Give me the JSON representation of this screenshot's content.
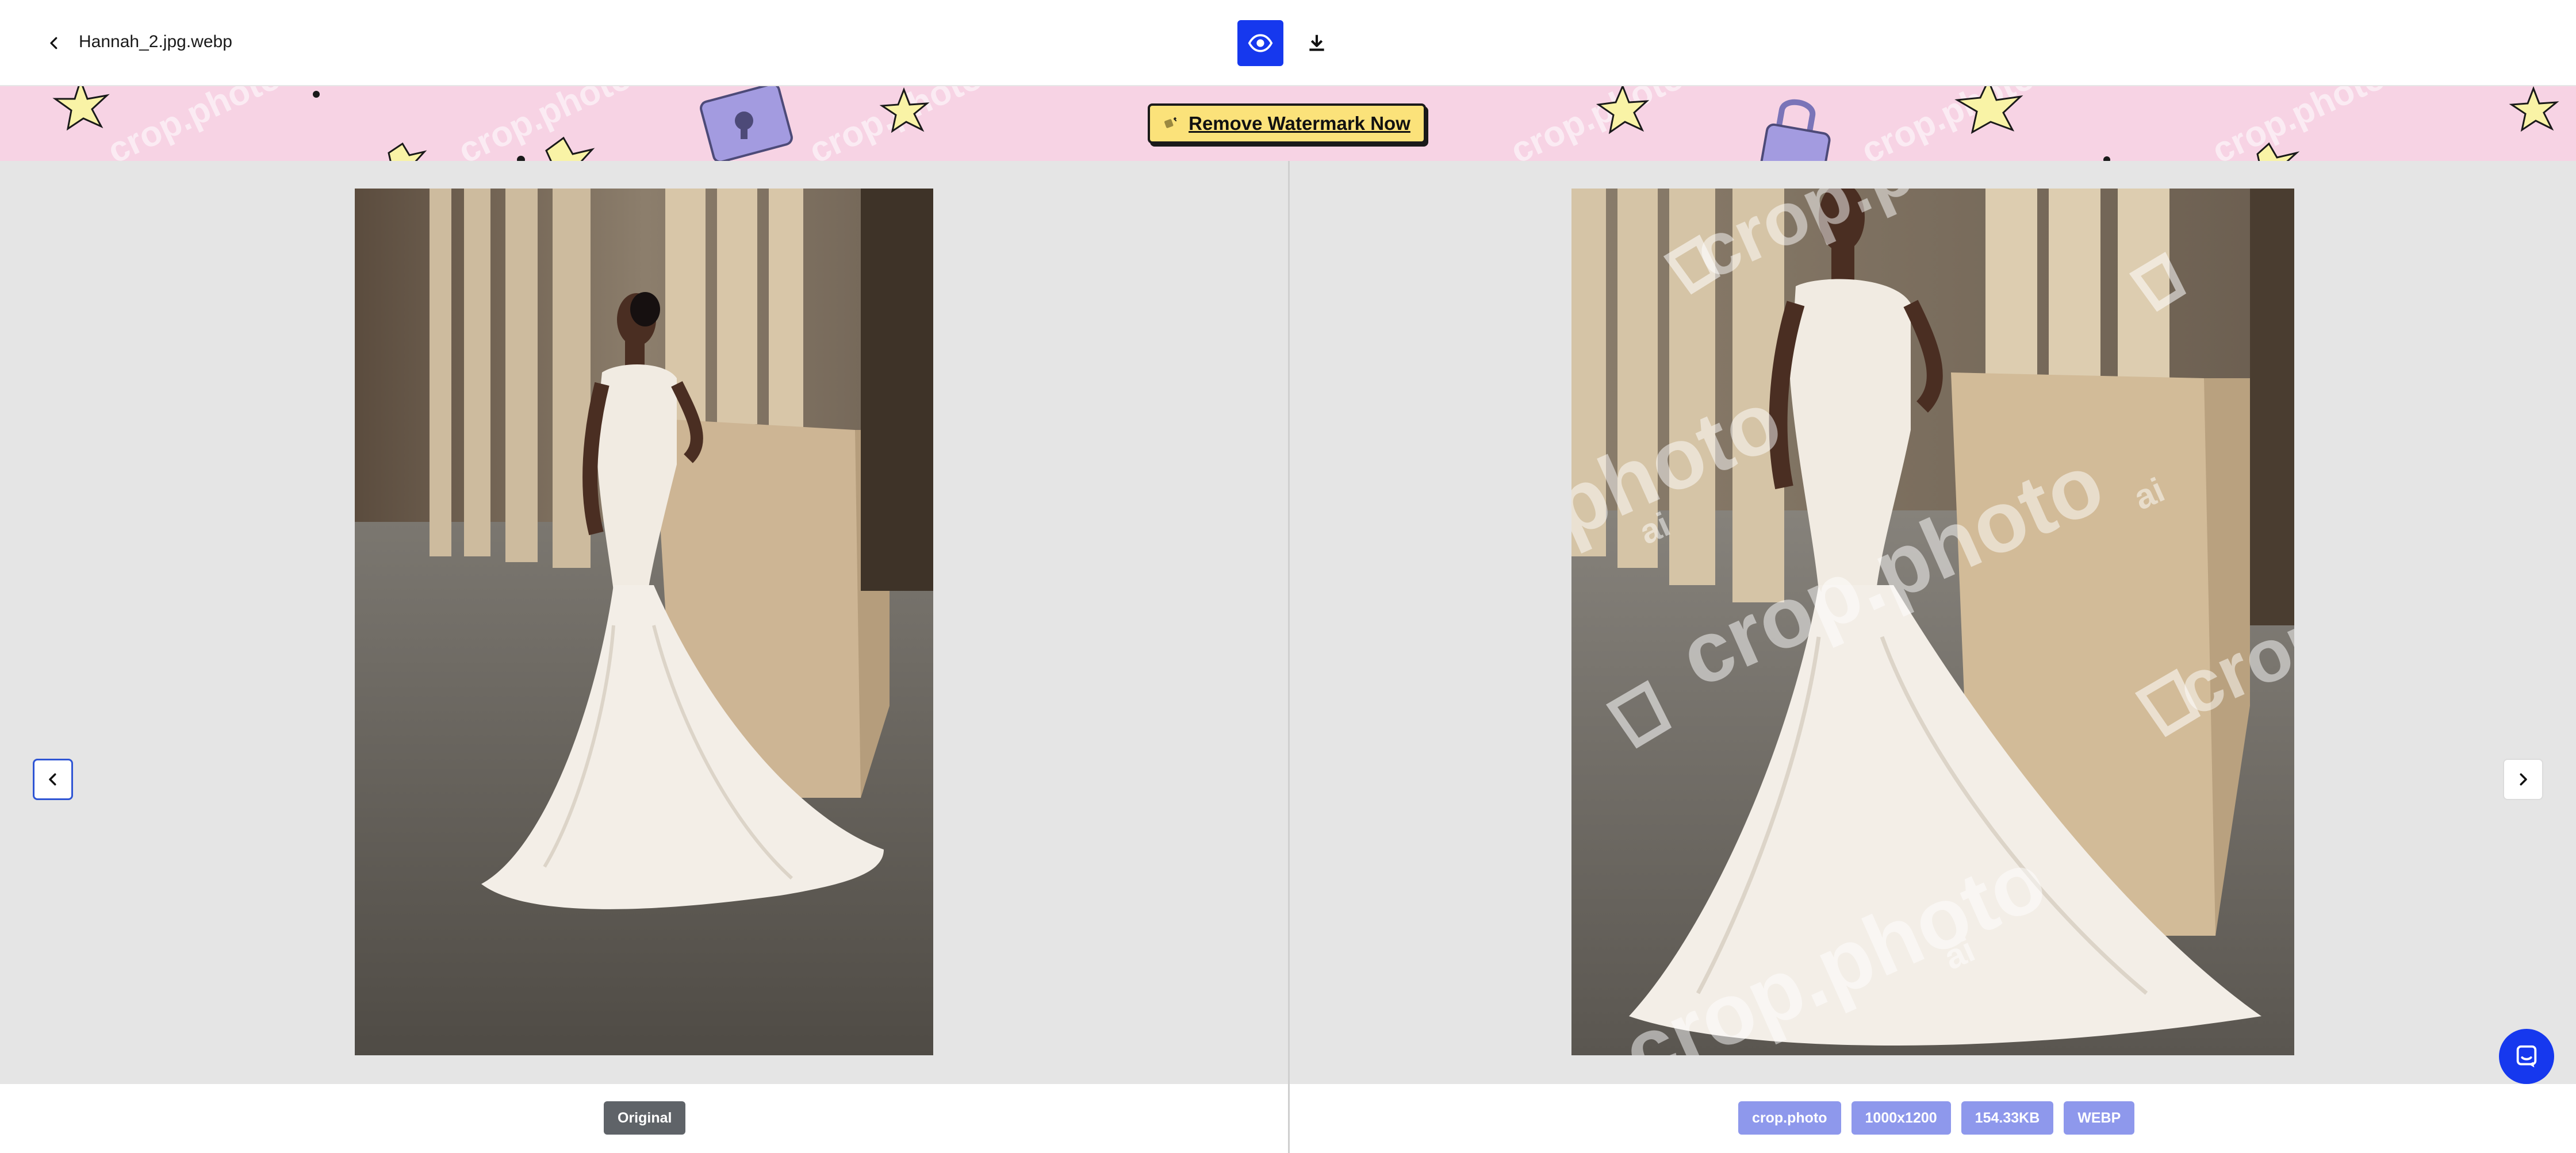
{
  "header": {
    "filename": "Hannah_2.jpg.webp",
    "back_icon": "chevron-left-icon",
    "view_icon": "eye-icon",
    "download_icon": "download-icon"
  },
  "banner": {
    "button_label": "Remove Watermark Now",
    "watermark_text": "crop.photo",
    "background_color": "#f7d3e4",
    "button_color": "#fbe27a"
  },
  "left_pane": {
    "badge": "Original"
  },
  "right_pane": {
    "badges": [
      "crop.photo",
      "1000x1200",
      "154.33KB",
      "WEBP"
    ],
    "watermark_text": "crop.photo",
    "watermark_suffix": "ai"
  },
  "navigation": {
    "prev_icon": "chevron-left-icon",
    "next_icon": "chevron-right-icon"
  },
  "chat": {
    "icon": "chat-icon"
  },
  "colors": {
    "accent": "#1638ee",
    "badge_blue": "#8e98ec",
    "badge_dark": "#5f6368"
  }
}
